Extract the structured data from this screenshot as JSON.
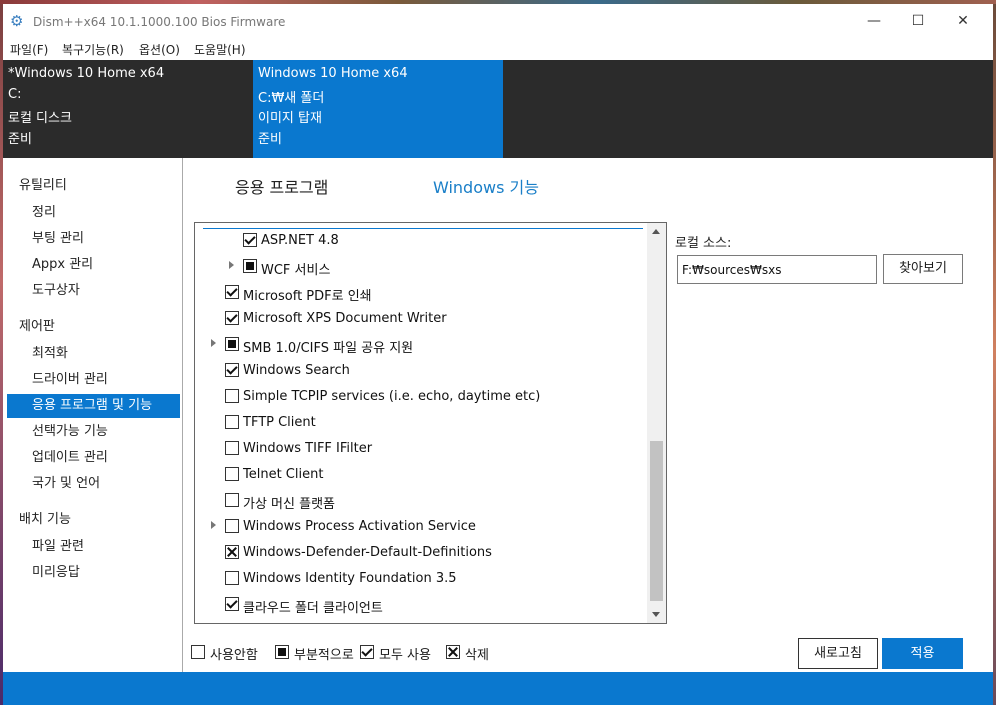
{
  "window": {
    "title": "Dism++x64 10.1.1000.100 Bios Firmware",
    "icon": "gear-icon"
  },
  "menu": [
    "파일(F)",
    "복구기능(R)",
    "옵션(O)",
    "도움말(H)"
  ],
  "images": [
    {
      "name": "*Windows 10 Home x64",
      "path": "C:",
      "type": "로컬 디스크",
      "status": "준비",
      "selected": false
    },
    {
      "name": "Windows 10 Home x64",
      "path": "C:₩새 폴더",
      "type": "이미지 탑재",
      "status": "준비",
      "selected": true
    }
  ],
  "sidebar": {
    "sections": [
      {
        "header": "유틸리티",
        "items": [
          "정리",
          "부팅 관리",
          "Appx 관리",
          "도구상자"
        ]
      },
      {
        "header": "제어판",
        "items": [
          "최적화",
          "드라이버 관리",
          "응용 프로그램 및 기능",
          "선택가능 기능",
          "업데이트 관리",
          "국가 및 언어"
        ]
      },
      {
        "header": "배치 기능",
        "items": [
          "파일 관련",
          "미리응답"
        ]
      }
    ],
    "active": "응용 프로그램 및 기능"
  },
  "tabs": {
    "apps": "응용 프로그램",
    "windows_features": "Windows 기능"
  },
  "features": [
    {
      "label": "ASP.NET 4.8",
      "state": "checked",
      "level": 2,
      "expandable": false
    },
    {
      "label": "WCF 서비스",
      "state": "partial",
      "level": 2,
      "expandable": true
    },
    {
      "label": "Microsoft PDF로 인쇄",
      "state": "checked",
      "level": 1,
      "expandable": false
    },
    {
      "label": "Microsoft XPS Document Writer",
      "state": "checked",
      "level": 1,
      "expandable": false
    },
    {
      "label": "SMB 1.0/CIFS 파일 공유 지원",
      "state": "partial",
      "level": 1,
      "expandable": true
    },
    {
      "label": "Windows Search",
      "state": "checked",
      "level": 1,
      "expandable": false
    },
    {
      "label": "Simple TCPIP services (i.e. echo, daytime etc)",
      "state": "unchecked",
      "level": 1,
      "expandable": false
    },
    {
      "label": "TFTP Client",
      "state": "unchecked",
      "level": 1,
      "expandable": false
    },
    {
      "label": "Windows TIFF IFilter",
      "state": "unchecked",
      "level": 1,
      "expandable": false
    },
    {
      "label": "Telnet Client",
      "state": "unchecked",
      "level": 1,
      "expandable": false
    },
    {
      "label": "가상 머신 플랫폼",
      "state": "unchecked",
      "level": 1,
      "expandable": false
    },
    {
      "label": "Windows Process Activation Service",
      "state": "unchecked",
      "level": 1,
      "expandable": true
    },
    {
      "label": "Windows-Defender-Default-Definitions",
      "state": "remove",
      "level": 1,
      "expandable": false
    },
    {
      "label": "Windows Identity Foundation 3.5",
      "state": "unchecked",
      "level": 1,
      "expandable": false
    },
    {
      "label": "클라우드 폴더 클라이언트",
      "state": "checked",
      "level": 1,
      "expandable": false
    }
  ],
  "local_source": {
    "label": "로컬 소스:",
    "value": "F:₩sources₩sxs",
    "browse_label": "찾아보기"
  },
  "legend": [
    {
      "label": "사용안함",
      "state": "unchecked"
    },
    {
      "label": "부분적으로",
      "state": "partial"
    },
    {
      "label": "모두 사용",
      "state": "checked"
    },
    {
      "label": "삭제",
      "state": "remove"
    }
  ],
  "buttons": {
    "refresh": "새로고침",
    "apply": "적용"
  },
  "colors": {
    "accent": "#0a78cf",
    "header_bg": "#2b2b2b"
  }
}
